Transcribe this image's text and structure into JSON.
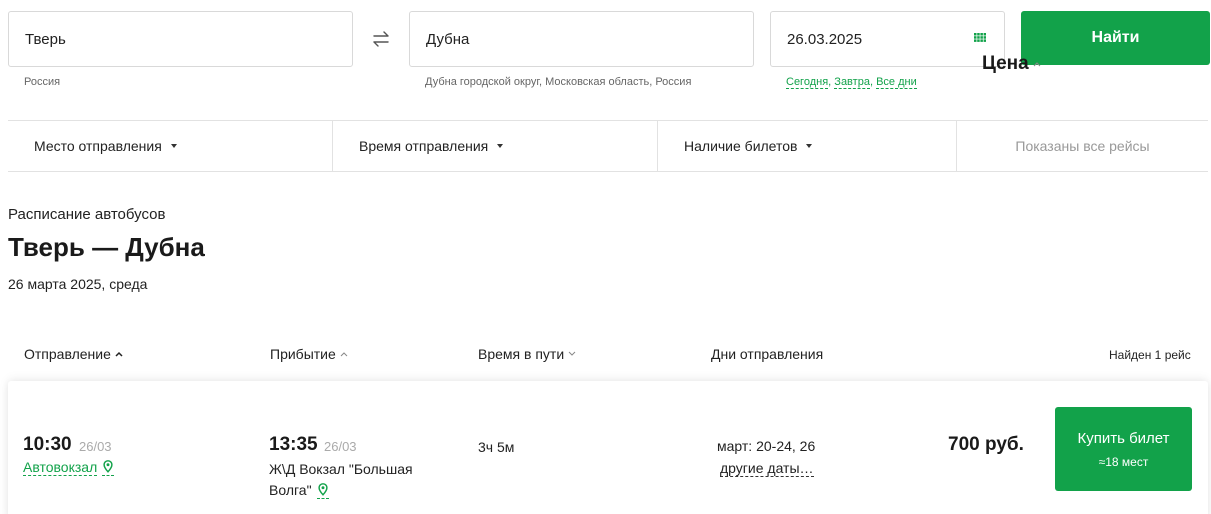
{
  "search": {
    "from_value": "Тверь",
    "from_sub": "Россия",
    "to_value": "Дубна",
    "to_sub": "Дубна городской округ, Московская область, Россия",
    "date_value": "26.03.2025",
    "date_links": [
      "Сегодня",
      "Завтра",
      "Все дни"
    ],
    "find_label": "Найти"
  },
  "filters": {
    "departure_place": "Место отправления",
    "departure_time": "Время отправления",
    "tickets": "Наличие билетов",
    "shown": "Показаны все рейсы"
  },
  "header": {
    "schedule_label": "Расписание автобусов",
    "route_title": "Тверь — Дубна",
    "route_date": "26 марта 2025, среда"
  },
  "table": {
    "columns": {
      "departure": "Отправление",
      "arrival": "Прибытие",
      "duration": "Время в пути",
      "days": "Дни отправления",
      "price": "Цена"
    },
    "found": "Найден 1 рейс",
    "rows": [
      {
        "dep_time": "10:30",
        "dep_date": "26/03",
        "dep_station": "Автовокзал",
        "arr_time": "13:35",
        "arr_date": "26/03",
        "arr_station": "Ж\\Д Вокзал \"Большая Волга\"",
        "duration": "3ч 5м",
        "days": "март: 20-24, 26",
        "other_dates": "другие даты…",
        "price": "700 руб.",
        "buy_label": "Купить билет",
        "seats": "≈18 мест"
      }
    ]
  },
  "colors": {
    "accent": "#12a24a"
  },
  "icons": {
    "swap": "swap-arrows-icon",
    "calendar": "calendar-icon",
    "pin": "map-pin-icon"
  }
}
